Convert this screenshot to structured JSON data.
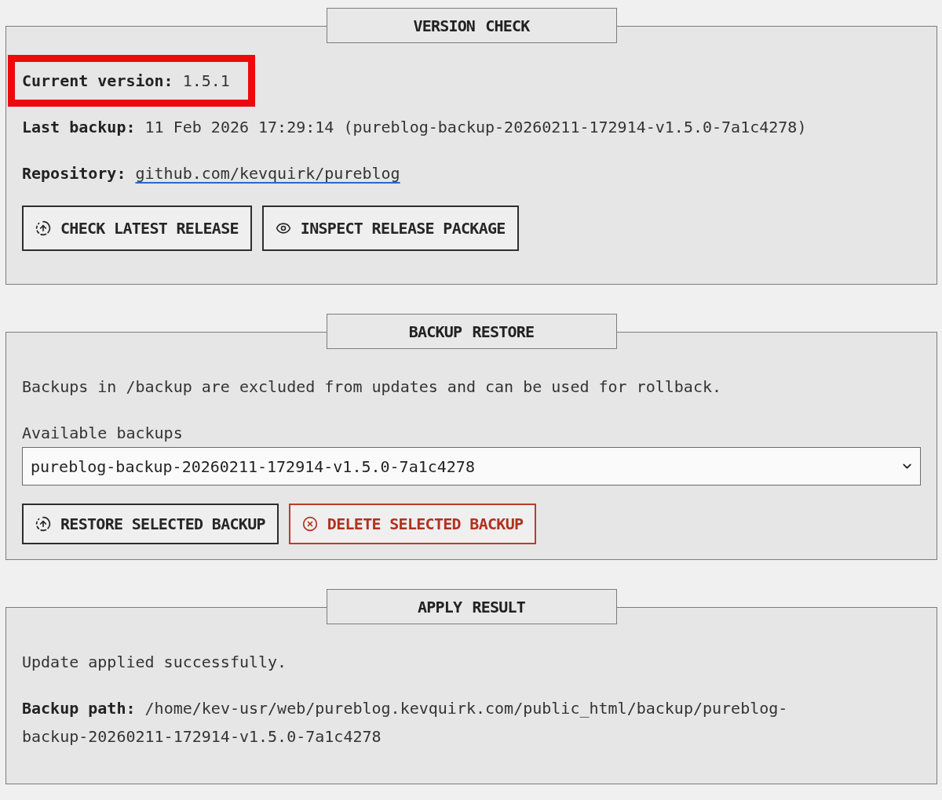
{
  "sections": [
    {
      "legend": "VERSION CHECK",
      "items": [
        {
          "kind": "field",
          "label": "Current version:",
          "value": "1.5.1",
          "highlighted": true
        },
        {
          "kind": "field",
          "label": "Last backup:",
          "value": "11 Feb 2026 17:29:14 (pureblog-backup-20260211-172914-v1.5.0-7a1c4278)",
          "highlighted": false
        },
        {
          "kind": "link_field",
          "label": "Repository:",
          "value": "github.com/kevquirk/pureblog",
          "highlighted": false
        },
        {
          "kind": "buttons",
          "buttons": [
            {
              "kind": "check",
              "label": "CHECK LATEST RELEASE"
            },
            {
              "kind": "inspect",
              "label": "INSPECT RELEASE PACKAGE"
            }
          ],
          "highlighted": false
        }
      ]
    },
    {
      "legend": "BACKUP RESTORE",
      "items": [
        {
          "kind": "text",
          "text": "Backups in /backup are excluded from updates and can be used for rollback.",
          "highlighted": false
        },
        {
          "kind": "select",
          "label": "Available backups",
          "value": "pureblog-backup-20260211-172914-v1.5.0-7a1c4278",
          "highlighted": false
        },
        {
          "kind": "buttons",
          "buttons": [
            {
              "kind": "restore",
              "label": "RESTORE SELECTED BACKUP"
            },
            {
              "kind": "delete",
              "label": "DELETE SELECTED BACKUP"
            }
          ],
          "highlighted": false
        }
      ]
    },
    {
      "legend": "APPLY RESULT",
      "items": [
        {
          "kind": "text",
          "text": "Update applied successfully.",
          "highlighted": false
        },
        {
          "kind": "field",
          "label": "Backup path:",
          "value": "/home/kev-usr/web/pureblog.kevquirk.com/public_html/backup/pureblog-backup-20260211-172914-v1.5.0-7a1c4278",
          "highlighted": false
        }
      ]
    }
  ]
}
